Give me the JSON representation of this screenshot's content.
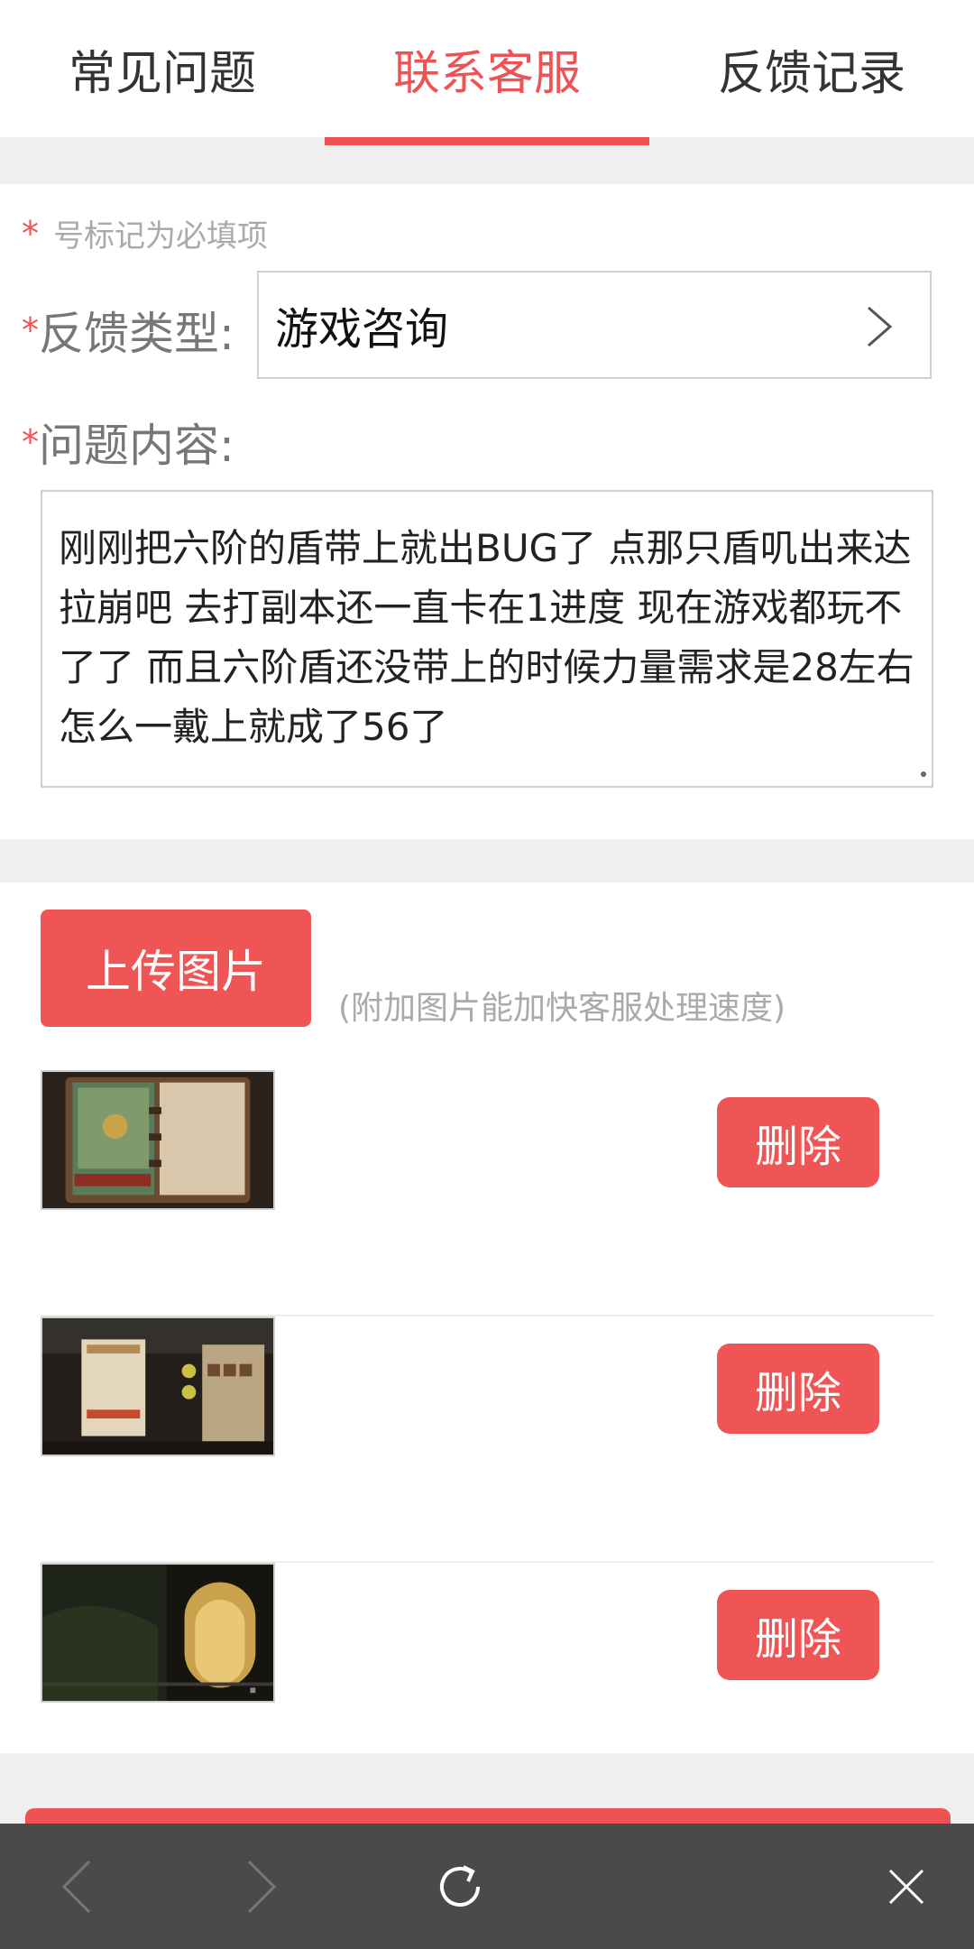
{
  "tabs": [
    {
      "label": "常见问题",
      "active": false
    },
    {
      "label": "联系客服",
      "active": true
    },
    {
      "label": "反馈记录",
      "active": false
    }
  ],
  "colors": {
    "accent": "#ee5253",
    "button": "#f05556",
    "muted": "#aaaaaa",
    "toolbar": "#4a4a4a"
  },
  "form": {
    "required_star": "*",
    "required_note": "号标记为必填项",
    "type_label": "反馈类型:",
    "type_value": "游戏咨询",
    "content_label": "问题内容:",
    "content_value": "刚刚把六阶的盾带上就出BUG了  点那只盾叽出来达拉崩吧  去打副本还一直卡在1进度  现在游戏都玩不了了  而且六阶盾还没带上的时候力量需求是28左右  怎么一戴上就成了56了"
  },
  "upload": {
    "button_label": "上传图片",
    "hint": "(附加图片能加快客服处理速度)",
    "images": [
      {
        "thumb": "game-screenshot-1",
        "delete_label": "删除"
      },
      {
        "thumb": "game-screenshot-2",
        "delete_label": "删除"
      },
      {
        "thumb": "game-screenshot-3",
        "delete_label": "删除"
      }
    ]
  },
  "toolbar": {
    "icons": [
      "back-arrow-icon",
      "forward-arrow-icon",
      "refresh-icon",
      "close-icon"
    ]
  }
}
